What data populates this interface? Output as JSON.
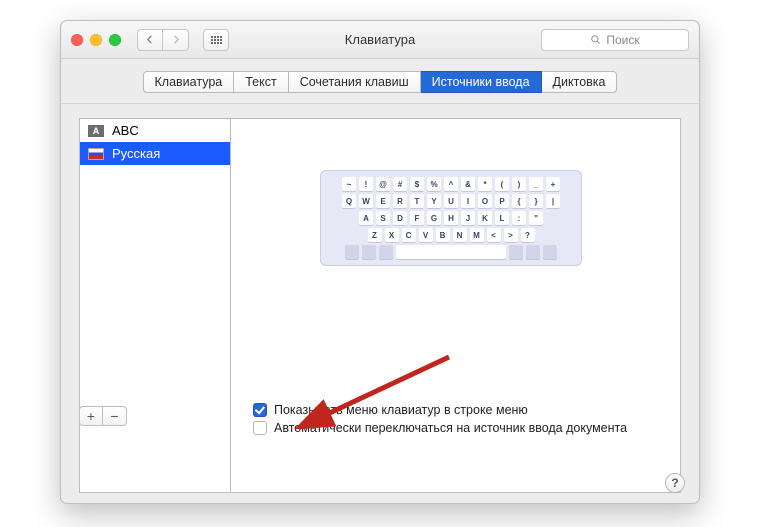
{
  "window": {
    "title": "Клавиатура",
    "search_placeholder": "Поиск"
  },
  "tabs": [
    {
      "id": "keyboard",
      "label": "Клавиатура"
    },
    {
      "id": "text",
      "label": "Текст"
    },
    {
      "id": "shortcuts",
      "label": "Сочетания клавиш"
    },
    {
      "id": "input",
      "label": "Источники ввода",
      "selected": true
    },
    {
      "id": "dictation",
      "label": "Диктовка"
    }
  ],
  "input_sources": [
    {
      "id": "abc",
      "name": "ABC"
    },
    {
      "id": "russian",
      "name": "Русская",
      "selected": true
    }
  ],
  "keyboard_rows": [
    [
      "~",
      "!",
      "@",
      "#",
      "$",
      "%",
      "^",
      "&",
      "*",
      "(",
      ")",
      "_",
      "+"
    ],
    [
      "Q",
      "W",
      "E",
      "R",
      "T",
      "Y",
      "U",
      "I",
      "O",
      "P",
      "{",
      "}",
      "|"
    ],
    [
      "A",
      "S",
      "D",
      "F",
      "G",
      "H",
      "J",
      "K",
      "L",
      ":",
      "\""
    ],
    [
      "Z",
      "X",
      "C",
      "V",
      "B",
      "N",
      "M",
      "<",
      ">",
      "?"
    ]
  ],
  "buttons": {
    "add": "+",
    "remove": "−"
  },
  "checkboxes": {
    "show_menu": {
      "label": "Показывать меню клавиатур в строке меню",
      "checked": true
    },
    "auto_switch": {
      "label": "Автоматически переключаться на источник ввода документа",
      "checked": false
    }
  },
  "help": "?"
}
